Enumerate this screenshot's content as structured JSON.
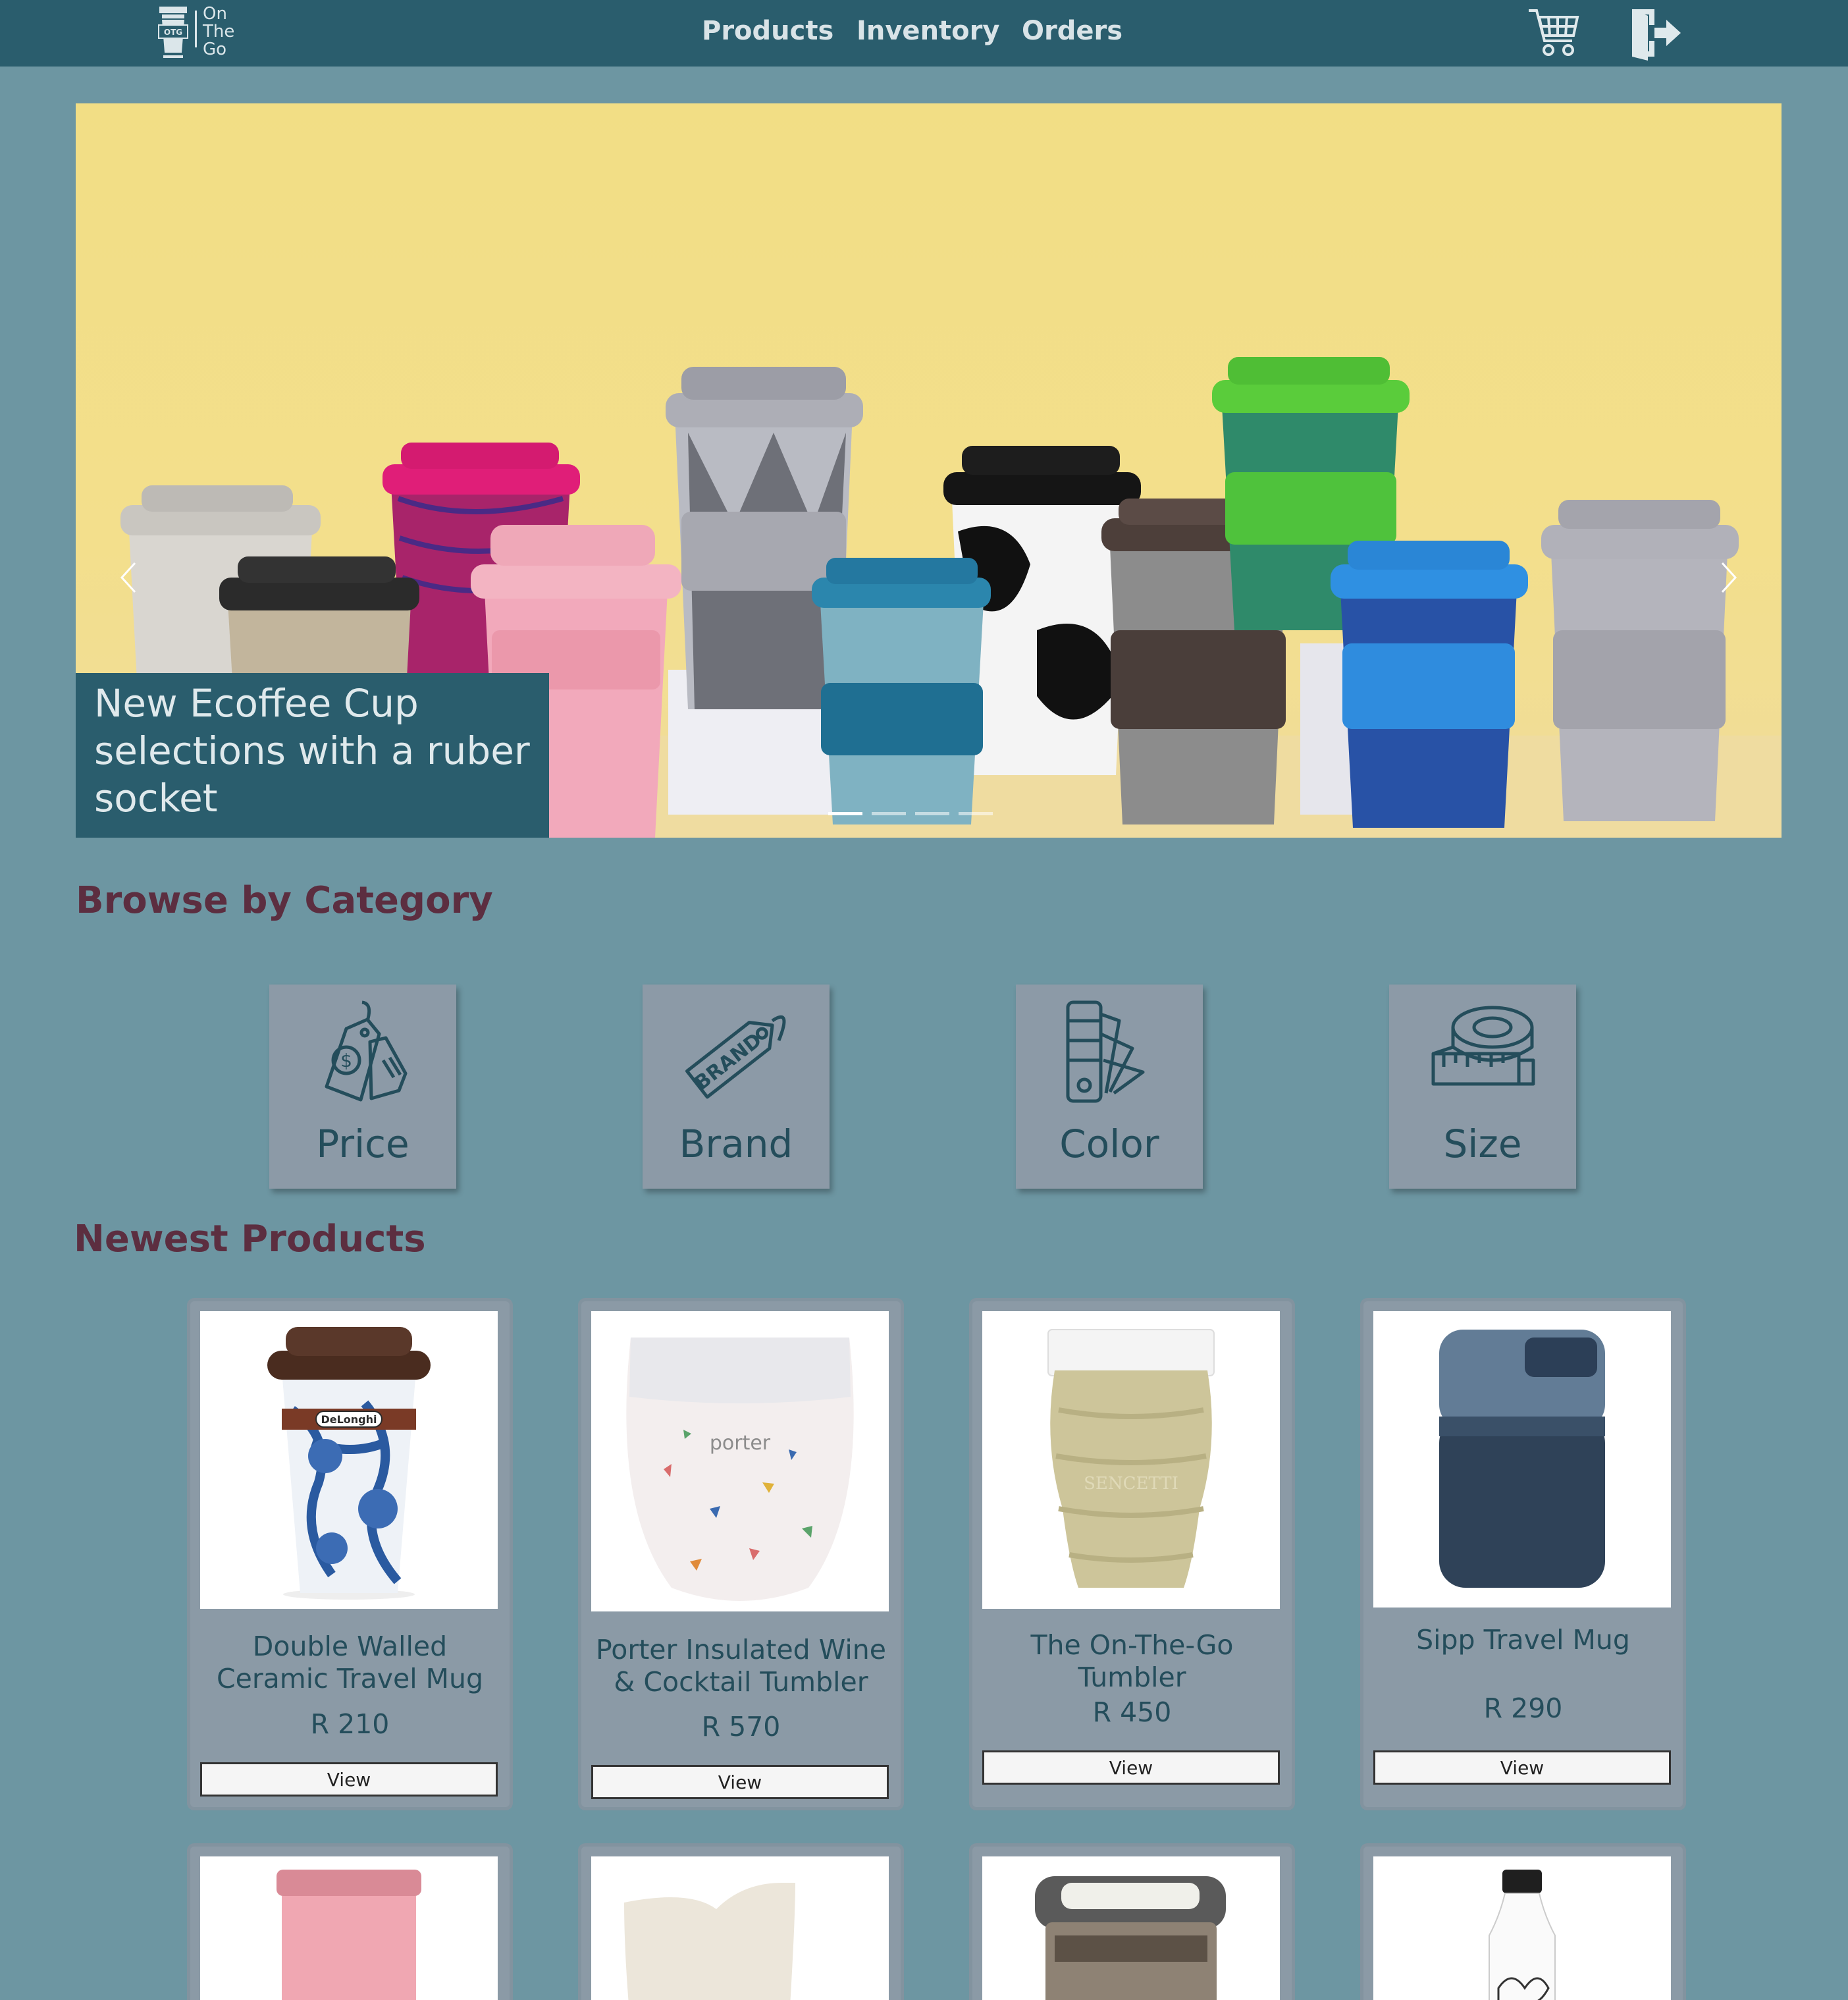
{
  "header": {
    "logo_small": "OTG",
    "logo_line1": "On",
    "logo_line2": "The",
    "logo_line3": "Go",
    "nav": [
      "Products",
      "Inventory",
      "Orders"
    ],
    "icons": [
      "cart-icon",
      "logout-icon"
    ]
  },
  "carousel": {
    "caption": "New Ecoffee Cup selections with a ruber socket",
    "indicator_count": 4,
    "active_indicator": 0,
    "icons": [
      "chevron-left-icon",
      "chevron-right-icon"
    ]
  },
  "browse": {
    "title": "Browse by Category",
    "categories": [
      {
        "label": "Price",
        "icon": "price-tag-icon"
      },
      {
        "label": "Brand",
        "icon": "brand-tag-icon"
      },
      {
        "label": "Color",
        "icon": "color-swatch-icon"
      },
      {
        "label": "Size",
        "icon": "measuring-tape-icon"
      }
    ]
  },
  "newest": {
    "title": "Newest Products",
    "products": [
      {
        "name": "Double Walled Ceramic Travel Mug",
        "price": "R 210",
        "view": "View",
        "brand_mark": "DeLonghi"
      },
      {
        "name": "Porter Insulated Wine & Cocktail Tumbler",
        "price": "R 570",
        "view": "View",
        "brand_mark": "porter"
      },
      {
        "name": "The On-The-Go Tumbler",
        "price": "R 450",
        "view": "View",
        "brand_mark": "SENCETTI"
      },
      {
        "name": "Sipp Travel Mug",
        "price": "R 290",
        "view": "View",
        "brand_mark": ""
      }
    ]
  },
  "colors": {
    "header_bg": "#2a5d6d",
    "page_bg": "#6d96a2",
    "tile_bg": "#8c9aa7",
    "heading": "#5c2e40",
    "text": "#244d5b"
  }
}
